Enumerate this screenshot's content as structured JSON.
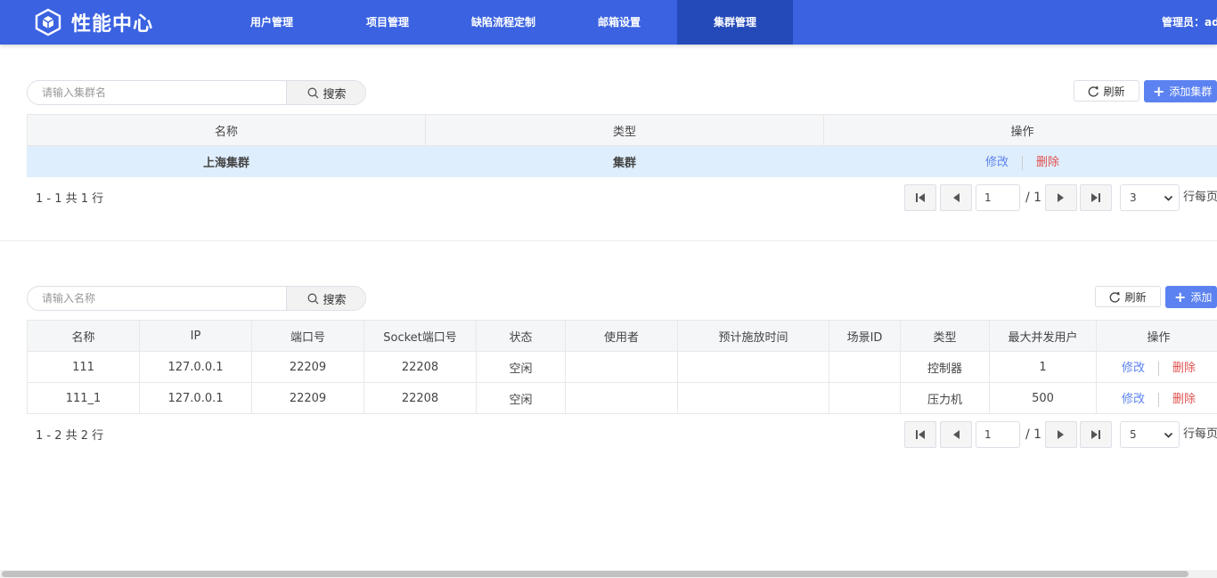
{
  "header": {
    "brand": "性能中心",
    "nav": [
      {
        "label": "用户管理"
      },
      {
        "label": "项目管理"
      },
      {
        "label": "缺陷流程定制"
      },
      {
        "label": "邮箱设置"
      },
      {
        "label": "集群管理",
        "active": true
      }
    ],
    "admin": "管理员：ad",
    "accent": "#3a62e1"
  },
  "cluster_section": {
    "search_placeholder": "请输入集群名",
    "search_label": "搜索",
    "refresh_label": "刷新",
    "add_label": "添加集群",
    "columns": [
      "名称",
      "类型",
      "操作"
    ],
    "rows": [
      {
        "name": "上海集群",
        "type": "集群",
        "edit": "修改",
        "delete": "删除"
      }
    ],
    "count_text": "1 - 1 共 1 行",
    "page_input": "1",
    "page_total": "/ 1",
    "page_size": "3",
    "page_suffix": "行每页"
  },
  "machine_section": {
    "search_placeholder": "请输入名称",
    "search_label": "搜索",
    "refresh_label": "刷新",
    "add_label": "添加",
    "columns": [
      "名称",
      "IP",
      "端口号",
      "Socket端口号",
      "状态",
      "使用者",
      "预计施放时间",
      "场景ID",
      "类型",
      "最大并发用户",
      "操作"
    ],
    "rows": [
      {
        "name": "111",
        "ip": "127.0.0.1",
        "port": "22209",
        "socket_port": "22208",
        "status": "空闲",
        "user": "",
        "release_time": "",
        "scene_id": "",
        "type": "控制器",
        "max_users": "1",
        "edit": "修改",
        "delete": "删除"
      },
      {
        "name": "111_1",
        "ip": "127.0.0.1",
        "port": "22209",
        "socket_port": "22208",
        "status": "空闲",
        "user": "",
        "release_time": "",
        "scene_id": "",
        "type": "压力机",
        "max_users": "500",
        "edit": "修改",
        "delete": "删除"
      }
    ],
    "count_text": "1 - 2 共 2 行",
    "page_input": "1",
    "page_total": "/ 1",
    "page_size": "5",
    "page_suffix": "行每页"
  }
}
